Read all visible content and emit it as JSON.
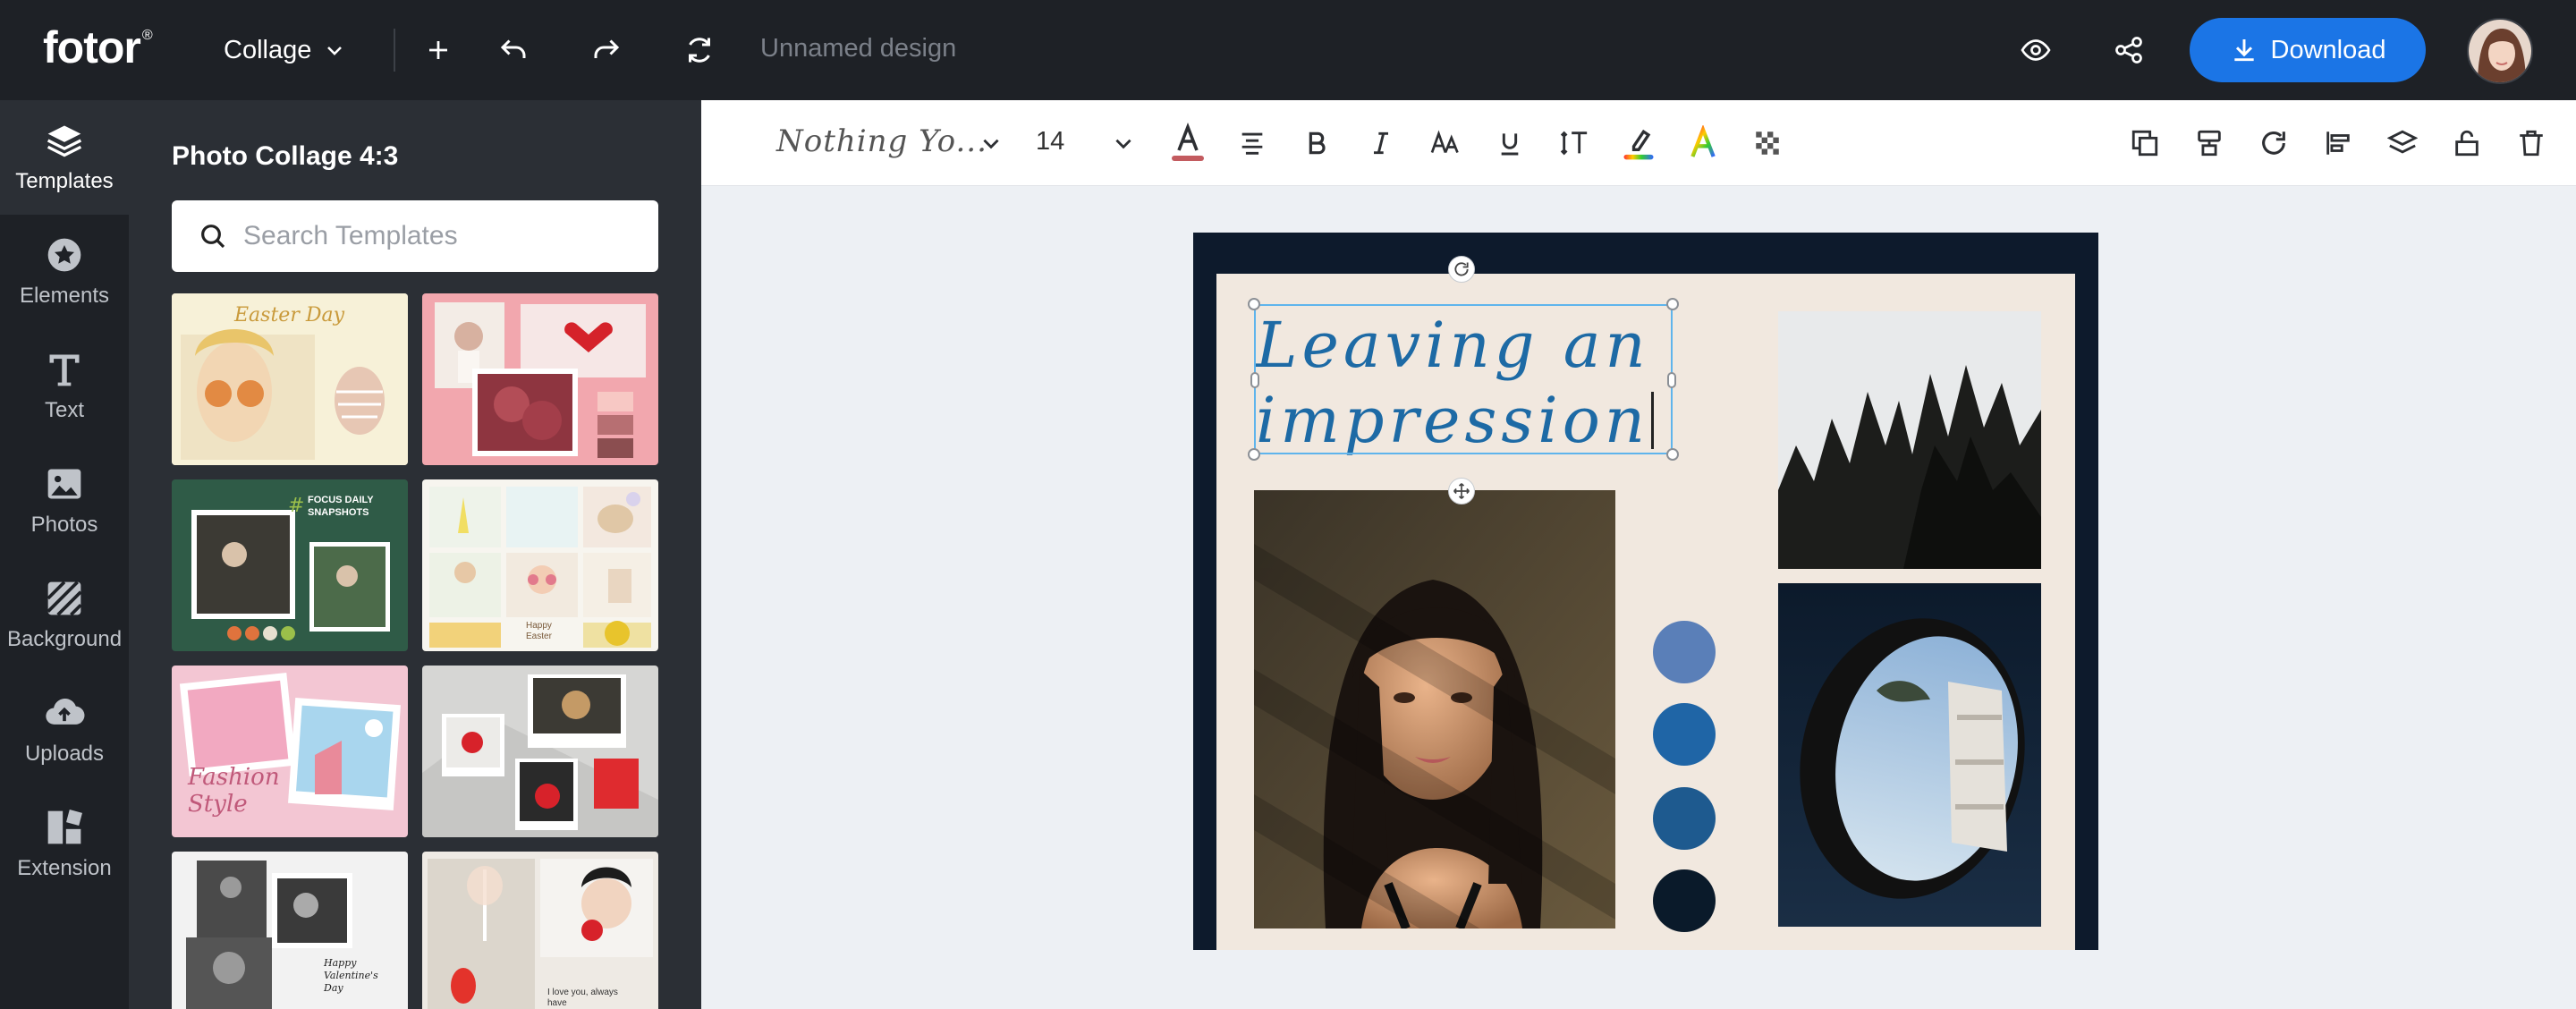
{
  "app": {
    "logo": "fotor",
    "logo_mark": "®",
    "mode_menu": "Collage",
    "doc_name": "Unnamed design",
    "download_label": "Download"
  },
  "rail": {
    "items": [
      {
        "label": "Templates",
        "icon": "layers-icon",
        "active": true
      },
      {
        "label": "Elements",
        "icon": "star-icon",
        "active": false
      },
      {
        "label": "Text",
        "icon": "text-icon",
        "active": false
      },
      {
        "label": "Photos",
        "icon": "photo-icon",
        "active": false
      },
      {
        "label": "Background",
        "icon": "stripes-icon",
        "active": false
      },
      {
        "label": "Uploads",
        "icon": "cloud-upload-icon",
        "active": false
      },
      {
        "label": "Extension",
        "icon": "extension-icon",
        "active": false
      }
    ]
  },
  "panel": {
    "title": "Photo Collage 4:3",
    "search_placeholder": "Search Templates",
    "templates": [
      {
        "caption": "Easter Day"
      },
      {
        "caption": ""
      },
      {
        "caption": "FOCUS DAILY SNAPSHOTS"
      },
      {
        "caption": "Happy Easter"
      },
      {
        "caption": "Fashion Style"
      },
      {
        "caption": ""
      },
      {
        "caption": "Happy Valentine's Day"
      },
      {
        "caption": "I love you, always have"
      }
    ]
  },
  "editor_toolbar": {
    "font_name": "Nothing Yo...",
    "font_size": "14"
  },
  "canvas": {
    "headline_line1": "Leaving an",
    "headline_line2": "impression",
    "swatches": [
      "#5a7fb8",
      "#1f65a6",
      "#1e5a8f",
      "#0a1a2a"
    ],
    "frame_color": "#0d1a2c",
    "paper_color": "#f1e8df",
    "text_color": "#1d6aa5"
  },
  "colors": {
    "accent": "#1b75e6",
    "chrome": "#1e2126",
    "panel": "#2b2f35",
    "selection": "#5fb4ec"
  }
}
